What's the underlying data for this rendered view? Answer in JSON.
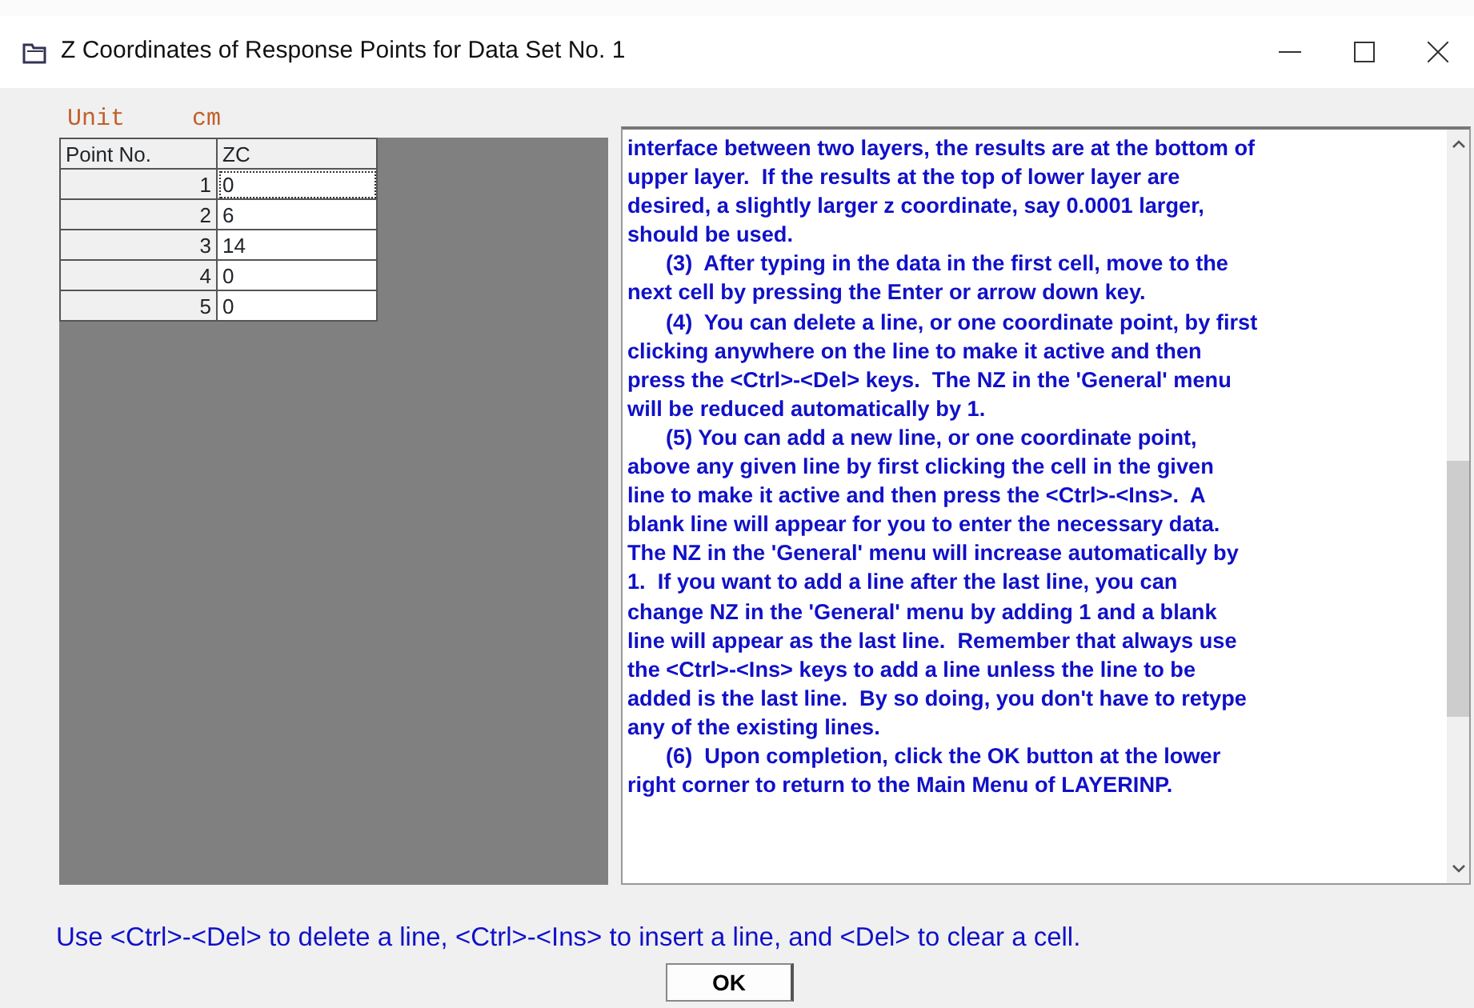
{
  "window": {
    "title": "Z Coordinates of Response Points for Data Set No. 1"
  },
  "unit": {
    "label": "Unit",
    "value": "cm"
  },
  "table": {
    "columns": [
      "Point No.",
      "ZC"
    ],
    "rows": [
      {
        "point": "1",
        "zc": "0",
        "selected": true
      },
      {
        "point": "2",
        "zc": "6",
        "selected": false
      },
      {
        "point": "3",
        "zc": "14",
        "selected": false
      },
      {
        "point": "4",
        "zc": "0",
        "selected": false
      },
      {
        "point": "5",
        "zc": "0",
        "selected": false
      }
    ]
  },
  "help": [
    {
      "indented": false,
      "text": "interface between two layers, the results are at the bottom of\nupper layer.  If the results at the top of lower layer are\ndesired, a slightly larger z coordinate, say 0.0001 larger,\nshould be used."
    },
    {
      "indented": true,
      "text": "(3)  After typing in the data in the first cell, move to the\nnext cell by pressing the Enter or arrow down key."
    },
    {
      "indented": true,
      "text": "(4)  You can delete a line, or one coordinate point, by first\nclicking anywhere on the line to make it active and then\npress the <Ctrl>-<Del> keys.  The NZ in the 'General' menu\nwill be reduced automatically by 1."
    },
    {
      "indented": true,
      "text": "(5) You can add a new line, or one coordinate point,\nabove any given line by first clicking the cell in the given\nline to make it active and then press the <Ctrl>-<Ins>.  A\nblank line will appear for you to enter the necessary data.\nThe NZ in the 'General' menu will increase automatically by\n1.  If you want to add a line after the last line, you can\nchange NZ in the 'General' menu by adding 1 and a blank\nline will appear as the last line.  Remember that always use\nthe <Ctrl>-<Ins> keys to add a line unless the line to be\nadded is the last line.  By so doing, you don't have to retype\nany of the existing lines."
    },
    {
      "indented": true,
      "text": "(6)  Upon completion, click the OK button at the lower\nright corner to return to the Main Menu of LAYERINP."
    }
  ],
  "hint": "Use <Ctrl>-<Del> to delete a line, <Ctrl>-<Ins> to insert a line, and <Del> to clear a cell.",
  "buttons": [
    {
      "label": "OK"
    }
  ]
}
